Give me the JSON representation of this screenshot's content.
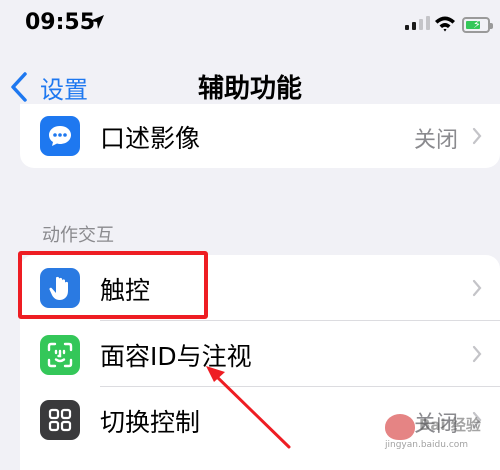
{
  "status_bar": {
    "time": "09:55"
  },
  "nav": {
    "back_label": "设置",
    "title": "辅助功能"
  },
  "rows_top": [
    {
      "label": "口述影像",
      "value": "关闭",
      "icon": "speech-bubble-icon",
      "icon_color": "#1e78f0"
    }
  ],
  "section_header": "动作交互",
  "rows_interaction": [
    {
      "label": "触控",
      "value": "",
      "icon": "hand-touch-icon",
      "icon_color": "#2a7ae2"
    },
    {
      "label": "面容ID与注视",
      "value": "",
      "icon": "face-id-icon",
      "icon_color": "#34c759"
    },
    {
      "label": "切换控制",
      "value": "关闭",
      "icon": "switch-grid-icon",
      "icon_color": "#3a3a3c"
    }
  ],
  "watermark": {
    "text": "Bai 经验",
    "url": "jingyan.baidu.com"
  },
  "colors": {
    "accent": "#1e78f0",
    "highlight": "#ee1d23",
    "background": "#f1f1f6"
  }
}
